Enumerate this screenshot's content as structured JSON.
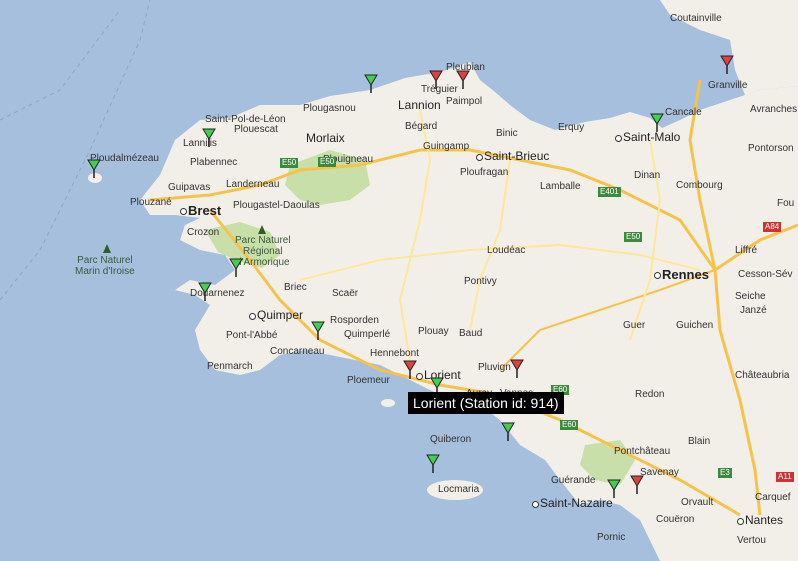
{
  "map": {
    "colors": {
      "sea": "#a5bfdd",
      "land": "#f2efe9",
      "park": "#c8dfaa",
      "road_major": "#f6c34a",
      "road_minor": "#fde79a"
    },
    "places": [
      {
        "name": "Coutainville",
        "size": "small"
      },
      {
        "name": "Granville",
        "size": "small"
      },
      {
        "name": "Avranches",
        "size": "small"
      },
      {
        "name": "Cancale",
        "size": "small"
      },
      {
        "name": "Saint-Malo",
        "size": "big"
      },
      {
        "name": "Pontorson",
        "size": "small"
      },
      {
        "name": "Pleubian",
        "size": "small"
      },
      {
        "name": "Tréguier",
        "size": "small"
      },
      {
        "name": "Paimpol",
        "size": "small"
      },
      {
        "name": "Lannion",
        "size": "big"
      },
      {
        "name": "Plougasnou",
        "size": "small"
      },
      {
        "name": "Saint-Pol-de-Léon",
        "size": "small"
      },
      {
        "name": "Lannilis",
        "size": "small"
      },
      {
        "name": "Plabennec",
        "size": "small"
      },
      {
        "name": "Plouescat",
        "size": "small"
      },
      {
        "name": "Morlaix",
        "size": "big"
      },
      {
        "name": "Plouigneau",
        "size": "small"
      },
      {
        "name": "Bégard",
        "size": "small"
      },
      {
        "name": "Guingamp",
        "size": "small"
      },
      {
        "name": "Binic",
        "size": "small"
      },
      {
        "name": "Erquy",
        "size": "small"
      },
      {
        "name": "Saint-Brieuc",
        "size": "big"
      },
      {
        "name": "Ploufragan",
        "size": "small"
      },
      {
        "name": "Lamballe",
        "size": "small"
      },
      {
        "name": "Dinan",
        "size": "small"
      },
      {
        "name": "Combourg",
        "size": "small"
      },
      {
        "name": "Ploudalmézeau",
        "size": "small"
      },
      {
        "name": "Guipavas",
        "size": "small"
      },
      {
        "name": "Landerneau",
        "size": "small"
      },
      {
        "name": "Plouzané",
        "size": "small"
      },
      {
        "name": "Brest",
        "size": "major"
      },
      {
        "name": "Plougastel-Daoulas",
        "size": "small"
      },
      {
        "name": "Crozon",
        "size": "small"
      },
      {
        "name": "Loudéac",
        "size": "small"
      },
      {
        "name": "Liffré",
        "size": "small"
      },
      {
        "name": "Rennes",
        "size": "major"
      },
      {
        "name": "Cesson-Sév",
        "size": "small"
      },
      {
        "name": "Seiche",
        "size": "small"
      },
      {
        "name": "Janzé",
        "size": "small"
      },
      {
        "name": "Pontivy",
        "size": "small"
      },
      {
        "name": "Douarnenez",
        "size": "small"
      },
      {
        "name": "Briec",
        "size": "small"
      },
      {
        "name": "Scaër",
        "size": "small"
      },
      {
        "name": "Rosporden",
        "size": "small"
      },
      {
        "name": "Quimper",
        "size": "big"
      },
      {
        "name": "Quimperlé",
        "size": "small"
      },
      {
        "name": "Plouay",
        "size": "small"
      },
      {
        "name": "Baud",
        "size": "small"
      },
      {
        "name": "Guer",
        "size": "small"
      },
      {
        "name": "Guichen",
        "size": "small"
      },
      {
        "name": "Pont-l'Abbé",
        "size": "small"
      },
      {
        "name": "Concarneau",
        "size": "small"
      },
      {
        "name": "Hennebont",
        "size": "small"
      },
      {
        "name": "Penmarch",
        "size": "small"
      },
      {
        "name": "Lorient",
        "size": "big"
      },
      {
        "name": "Pluvign",
        "size": "small"
      },
      {
        "name": "Ploemeur",
        "size": "small"
      },
      {
        "name": "Auray",
        "size": "small"
      },
      {
        "name": "Vannes",
        "size": "small"
      },
      {
        "name": "Châteaubria",
        "size": "small"
      },
      {
        "name": "Redon",
        "size": "small"
      },
      {
        "name": "Quiberon",
        "size": "small"
      },
      {
        "name": "Blain",
        "size": "small"
      },
      {
        "name": "Pontchâteau",
        "size": "small"
      },
      {
        "name": "Savenay",
        "size": "small"
      },
      {
        "name": "Guérande",
        "size": "small"
      },
      {
        "name": "Saint-Nazaire",
        "size": "big"
      },
      {
        "name": "Locmaria",
        "size": "small"
      },
      {
        "name": "Orvault",
        "size": "small"
      },
      {
        "name": "Carquef",
        "size": "small"
      },
      {
        "name": "Nantes",
        "size": "big"
      },
      {
        "name": "Pornic",
        "size": "small"
      },
      {
        "name": "Couëron",
        "size": "small"
      },
      {
        "name": "Vertou",
        "size": "small"
      },
      {
        "name": "Fou",
        "size": "small"
      }
    ],
    "parks": [
      {
        "name": "Parc Naturel\nMarin d'Iroise"
      },
      {
        "name": "Parc Naturel\nRégional\nd'Armorique"
      }
    ],
    "road_shields": [
      "E50",
      "E50",
      "E401",
      "E50",
      "A84",
      "E60",
      "E60",
      "E3",
      "A11"
    ],
    "stations": [
      {
        "status": "green"
      },
      {
        "status": "red"
      },
      {
        "status": "red"
      },
      {
        "status": "green"
      },
      {
        "status": "green"
      },
      {
        "status": "red"
      },
      {
        "status": "green"
      },
      {
        "status": "green"
      },
      {
        "status": "green"
      },
      {
        "status": "green"
      },
      {
        "status": "red"
      },
      {
        "status": "green"
      },
      {
        "status": "red"
      },
      {
        "status": "green"
      },
      {
        "status": "green"
      },
      {
        "status": "green"
      },
      {
        "status": "red"
      }
    ],
    "tooltip": "Lorient (Station id: 914)"
  }
}
